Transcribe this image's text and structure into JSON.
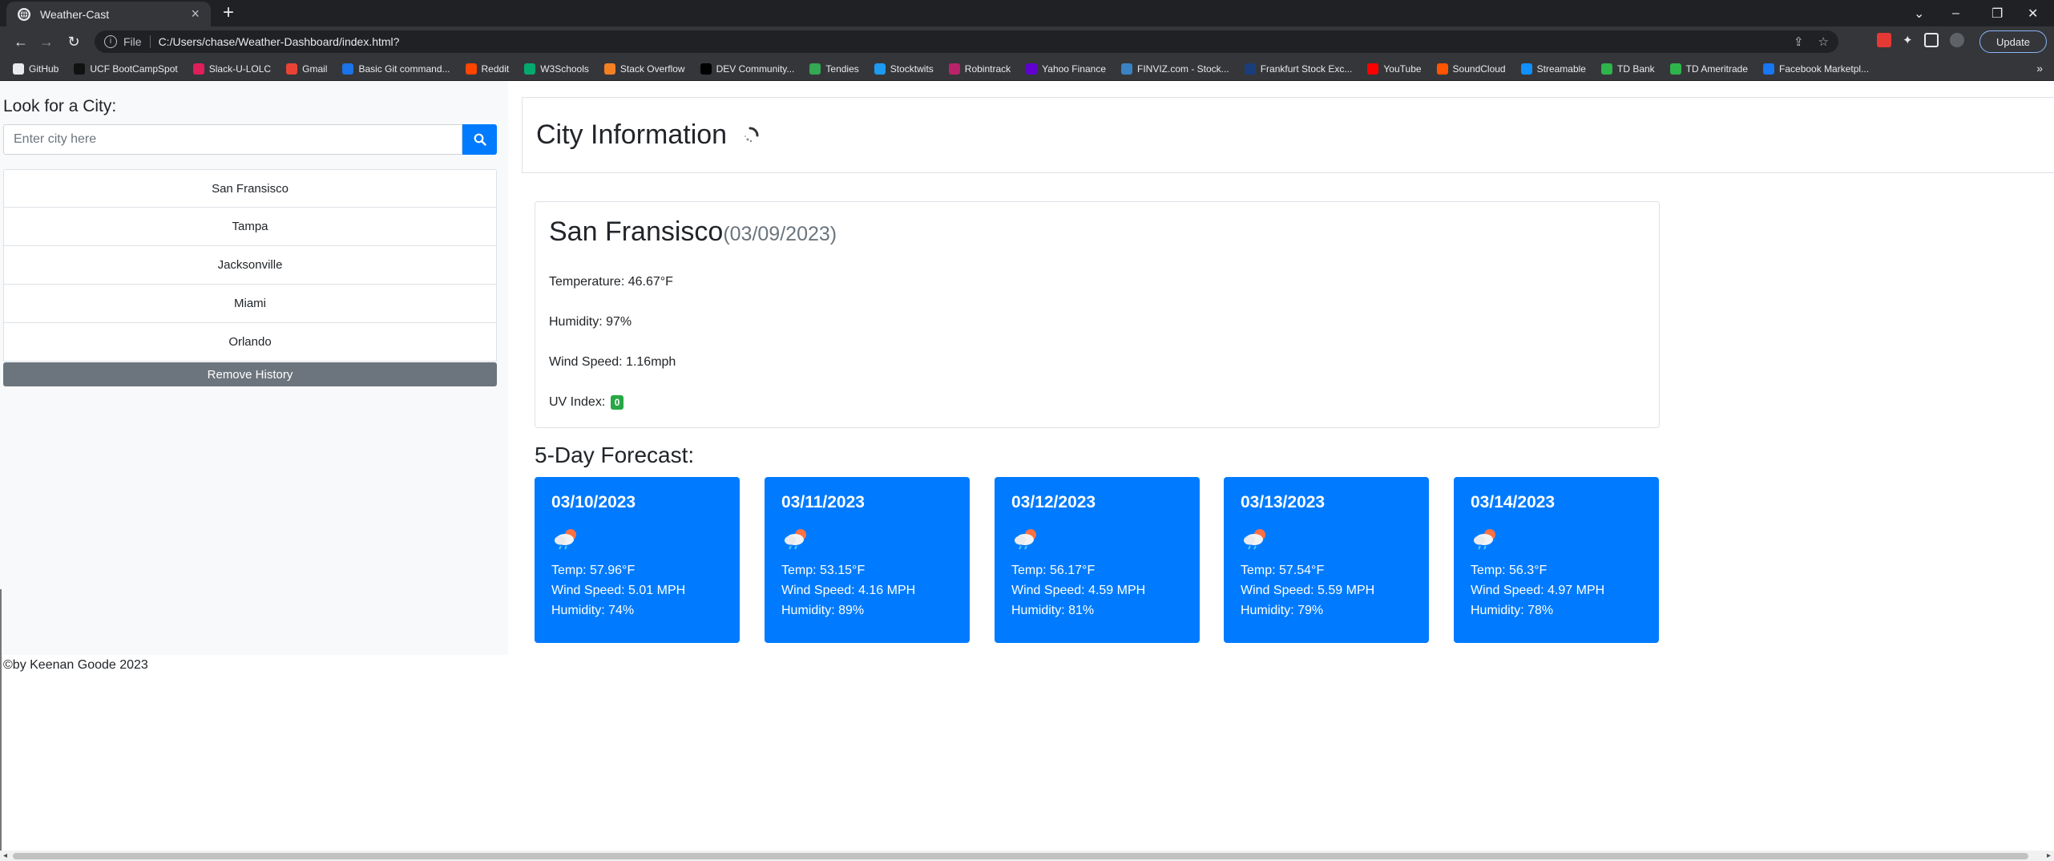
{
  "browser": {
    "tab_title": "Weather-Cast",
    "tab_close": "×",
    "new_tab": "+",
    "protocol": "File",
    "url": "C:/Users/chase/Weather-Dashboard/index.html?",
    "update_label": "Update",
    "bookmarks": [
      {
        "label": "GitHub",
        "color": "#e8eaed"
      },
      {
        "label": "UCF BootCampSpot",
        "color": "#111111"
      },
      {
        "label": "Slack-U-LOLC",
        "color": "#e01e5a"
      },
      {
        "label": "Gmail",
        "color": "#ea4335"
      },
      {
        "label": "Basic Git command...",
        "color": "#1a73e8"
      },
      {
        "label": "Reddit",
        "color": "#ff4500"
      },
      {
        "label": "W3Schools",
        "color": "#04aa6d"
      },
      {
        "label": "Stack Overflow",
        "color": "#f48024"
      },
      {
        "label": "DEV Community...",
        "color": "#000000"
      },
      {
        "label": "Tendies",
        "color": "#34a853"
      },
      {
        "label": "Stocktwits",
        "color": "#1d9bf0"
      },
      {
        "label": "Robintrack",
        "color": "#b8236b"
      },
      {
        "label": "Yahoo Finance",
        "color": "#6001d2"
      },
      {
        "label": "FINVIZ.com - Stock...",
        "color": "#3b82c4"
      },
      {
        "label": "Frankfurt Stock Exc...",
        "color": "#1a3d7c"
      },
      {
        "label": "YouTube",
        "color": "#ff0000"
      },
      {
        "label": "SoundCloud",
        "color": "#ff5500"
      },
      {
        "label": "Streamable",
        "color": "#0f90fa"
      },
      {
        "label": "TD Bank",
        "color": "#2fb44b"
      },
      {
        "label": "TD Ameritrade",
        "color": "#2fb44b"
      },
      {
        "label": "Facebook Marketpl...",
        "color": "#1877f2"
      }
    ],
    "bookmarks_more": "»"
  },
  "sidebar": {
    "heading": "Look for a City:",
    "search_placeholder": "Enter city here",
    "history": [
      "San Fransisco",
      "Tampa",
      "Jacksonville",
      "Miami",
      "Orlando"
    ],
    "remove_label": "Remove History"
  },
  "header": {
    "title": "City Information"
  },
  "current": {
    "city": "San Fransisco",
    "date": "(03/09/2023)",
    "temperature": "Temperature: 46.67°F",
    "humidity": "Humidity: 97%",
    "wind": "Wind Speed: 1.16mph",
    "uv_label": "UV Index:",
    "uv_value": "0"
  },
  "forecast": {
    "title": "5-Day Forecast:",
    "days": [
      {
        "date": "03/10/2023",
        "temp": "Temp: 57.96°F",
        "wind": "Wind Speed: 5.01 MPH",
        "humidity": "Humidity: 74%"
      },
      {
        "date": "03/11/2023",
        "temp": "Temp: 53.15°F",
        "wind": "Wind Speed: 4.16 MPH",
        "humidity": "Humidity: 89%"
      },
      {
        "date": "03/12/2023",
        "temp": "Temp: 56.17°F",
        "wind": "Wind Speed: 4.59 MPH",
        "humidity": "Humidity: 81%"
      },
      {
        "date": "03/13/2023",
        "temp": "Temp: 57.54°F",
        "wind": "Wind Speed: 5.59 MPH",
        "humidity": "Humidity: 79%"
      },
      {
        "date": "03/14/2023",
        "temp": "Temp: 56.3°F",
        "wind": "Wind Speed: 4.97 MPH",
        "humidity": "Humidity: 78%"
      }
    ]
  },
  "footer": {
    "text": "©by Keenan Goode 2023"
  },
  "colors": {
    "primary": "#007bff",
    "secondary": "#6c757d",
    "success": "#28a745"
  }
}
